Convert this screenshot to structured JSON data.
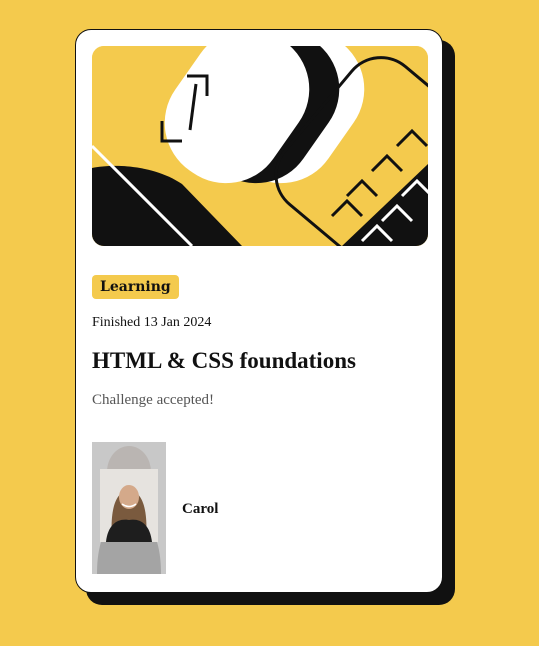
{
  "card": {
    "category": "Learning",
    "published": "Finished 13 Jan 2024",
    "title": "HTML & CSS foundations",
    "description": "Challenge accepted!",
    "author": {
      "name": "Carol"
    }
  },
  "colors": {
    "background": "#f4ca4d",
    "card": "#ffffff",
    "ink": "#111111",
    "muted": "#555555"
  },
  "icons": {
    "hero": "abstract-illustration",
    "avatar": "author-photo"
  }
}
